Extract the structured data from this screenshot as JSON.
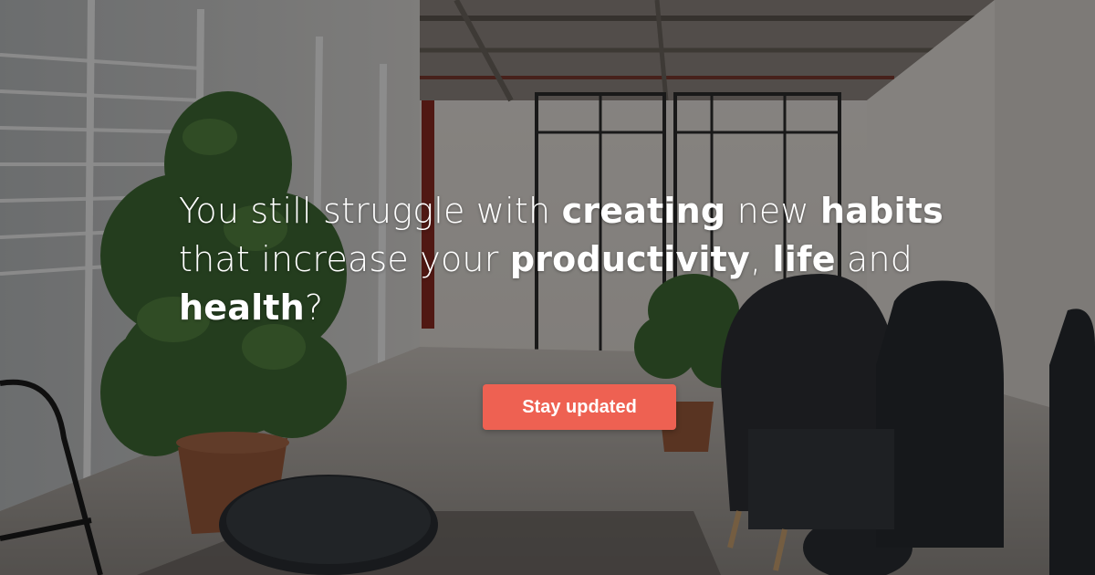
{
  "hero": {
    "headline": {
      "segments": [
        {
          "text": "You still struggle with ",
          "bold": false
        },
        {
          "text": "creating",
          "bold": true
        },
        {
          "text": " new ",
          "bold": false
        },
        {
          "text": "habits",
          "bold": true
        },
        {
          "text": " that increase your ",
          "bold": false
        },
        {
          "text": "productivity",
          "bold": true
        },
        {
          "text": ", ",
          "bold": false
        },
        {
          "text": "life",
          "bold": true
        },
        {
          "text": " and ",
          "bold": false
        },
        {
          "text": "health",
          "bold": true
        },
        {
          "text": "?",
          "bold": false
        }
      ]
    },
    "cta_label": "Stay updated",
    "colors": {
      "accent": "#ee6152",
      "text": "#ffffff"
    }
  }
}
